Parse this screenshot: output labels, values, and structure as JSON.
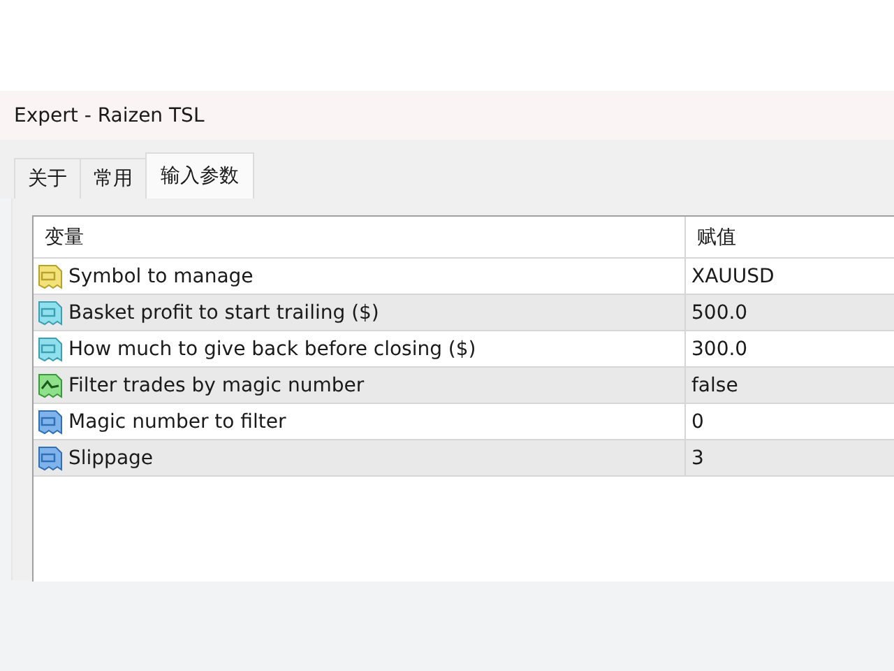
{
  "window": {
    "title": "Expert - Raizen TSL"
  },
  "tabs": [
    {
      "label": "关于",
      "selected": false
    },
    {
      "label": "常用",
      "selected": false
    },
    {
      "label": "输入参数",
      "selected": true
    }
  ],
  "table": {
    "columns": [
      "变量",
      "赋值"
    ],
    "rows": [
      {
        "kind": "string",
        "name": "Symbol to manage",
        "value": "XAUUSD"
      },
      {
        "kind": "double",
        "name": "Basket profit to start trailing ($)",
        "value": "500.0"
      },
      {
        "kind": "double",
        "name": "How much to give back before closing ($)",
        "value": "300.0"
      },
      {
        "kind": "bool",
        "name": "Filter trades by magic number",
        "value": "false"
      },
      {
        "kind": "int",
        "name": "Magic number to filter",
        "value": "0"
      },
      {
        "kind": "int",
        "name": "Slippage",
        "value": "3"
      }
    ]
  }
}
